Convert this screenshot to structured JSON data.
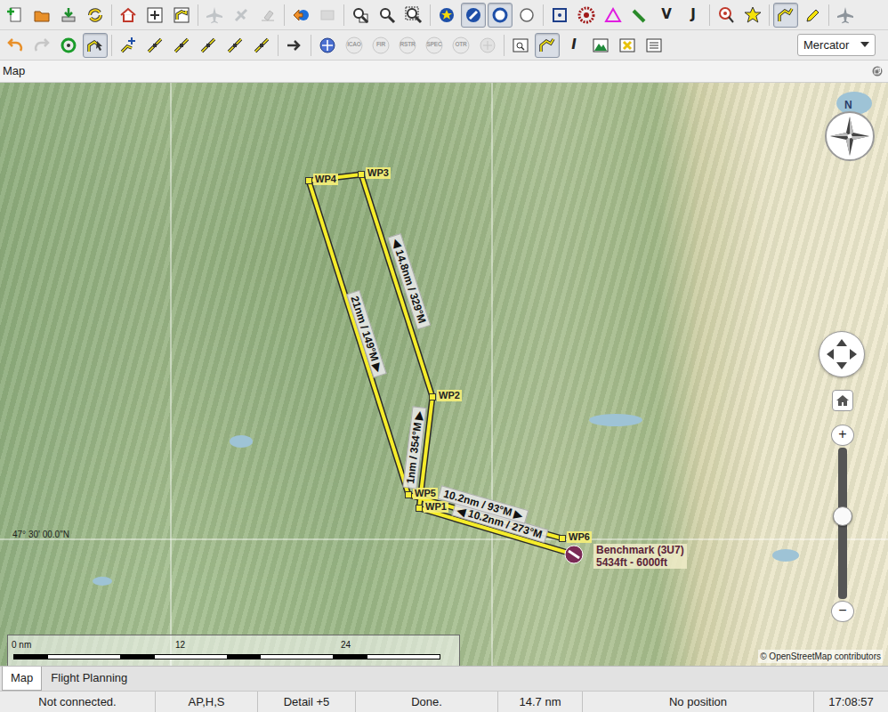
{
  "toolbars": [
    {
      "groups": [
        [
          {
            "kind": "new",
            "pressed": false,
            "disabled": false
          },
          {
            "kind": "open",
            "pressed": false,
            "disabled": false
          },
          {
            "kind": "save",
            "pressed": false,
            "disabled": false
          },
          {
            "kind": "reload",
            "pressed": false,
            "disabled": false
          }
        ],
        [
          {
            "kind": "home",
            "pressed": false,
            "disabled": false
          },
          {
            "kind": "center",
            "pressed": false,
            "disabled": false
          },
          {
            "kind": "routebox",
            "pressed": false,
            "disabled": false
          }
        ],
        [
          {
            "kind": "plane",
            "pressed": false,
            "disabled": true
          },
          {
            "kind": "satellite",
            "pressed": false,
            "disabled": true
          },
          {
            "kind": "erase",
            "pressed": false,
            "disabled": true
          }
        ],
        [
          {
            "kind": "back",
            "pressed": false,
            "disabled": false
          },
          {
            "kind": "forward",
            "pressed": false,
            "disabled": true
          }
        ],
        [
          {
            "kind": "zoomdoc",
            "pressed": false,
            "disabled": false
          },
          {
            "kind": "zoom",
            "pressed": false,
            "disabled": false
          },
          {
            "kind": "zoomrect",
            "pressed": false,
            "disabled": false
          }
        ],
        [
          {
            "kind": "starcircle",
            "pressed": false,
            "disabled": false
          },
          {
            "kind": "slash",
            "pressed": true,
            "disabled": false
          },
          {
            "kind": "ring",
            "pressed": true,
            "disabled": false
          },
          {
            "kind": "circle",
            "pressed": false,
            "disabled": false
          }
        ],
        [
          {
            "kind": "vor",
            "pressed": false,
            "disabled": false
          },
          {
            "kind": "ndb",
            "pressed": false,
            "disabled": false
          },
          {
            "kind": "triangle",
            "pressed": false,
            "disabled": false
          },
          {
            "kind": "marker",
            "pressed": false,
            "disabled": false
          },
          {
            "kind": "letter",
            "label": "V",
            "pressed": false,
            "disabled": false
          },
          {
            "kind": "letter",
            "label": "J",
            "pressed": false,
            "disabled": false
          }
        ],
        [
          {
            "kind": "target",
            "pressed": false,
            "disabled": false
          },
          {
            "kind": "star",
            "pressed": false,
            "disabled": false
          }
        ],
        [
          {
            "kind": "route",
            "pressed": true,
            "disabled": false
          },
          {
            "kind": "pen",
            "pressed": false,
            "disabled": false
          }
        ],
        [
          {
            "kind": "plane",
            "pressed": false,
            "disabled": false
          }
        ]
      ]
    },
    {
      "groups": [
        [
          {
            "kind": "undo",
            "pressed": false,
            "disabled": false
          },
          {
            "kind": "redo",
            "pressed": false,
            "disabled": true
          },
          {
            "kind": "search",
            "pressed": false,
            "disabled": false
          },
          {
            "kind": "pointer",
            "pressed": true,
            "disabled": false
          }
        ],
        [
          {
            "kind": "addroute",
            "pressed": false,
            "disabled": false
          },
          {
            "kind": "leg",
            "pressed": false,
            "disabled": false
          },
          {
            "kind": "leg",
            "pressed": false,
            "disabled": false
          },
          {
            "kind": "leg",
            "pressed": false,
            "disabled": false
          },
          {
            "kind": "leg",
            "pressed": false,
            "disabled": false
          },
          {
            "kind": "leg",
            "pressed": false,
            "disabled": false
          }
        ],
        [
          {
            "kind": "planearrow",
            "pressed": false,
            "disabled": false
          }
        ],
        [
          {
            "kind": "compass",
            "pressed": false,
            "disabled": false
          },
          {
            "kind": "airspace",
            "label": "ICAO",
            "pressed": false,
            "disabled": true
          },
          {
            "kind": "airspace",
            "label": "FIR",
            "pressed": false,
            "disabled": true
          },
          {
            "kind": "airspace",
            "label": "RSTR",
            "pressed": false,
            "disabled": true
          },
          {
            "kind": "airspace",
            "label": "SPEC",
            "pressed": false,
            "disabled": true
          },
          {
            "kind": "airspace",
            "label": "OTR",
            "pressed": false,
            "disabled": true
          },
          {
            "kind": "airspacegrey",
            "pressed": false,
            "disabled": true
          }
        ],
        [
          {
            "kind": "window",
            "pressed": false,
            "disabled": false
          },
          {
            "kind": "route",
            "pressed": true,
            "disabled": false
          },
          {
            "kind": "letter",
            "label": "I",
            "pressed": false,
            "disabled": false
          },
          {
            "kind": "mountain",
            "pressed": false,
            "disabled": false
          },
          {
            "kind": "cross",
            "pressed": false,
            "disabled": false
          },
          {
            "kind": "list",
            "pressed": false,
            "disabled": false
          }
        ]
      ],
      "projection": "Mercator"
    }
  ],
  "panel": {
    "title": "Map"
  },
  "map": {
    "grid_label": "47° 30' 00.0\"N",
    "waypoints": [
      {
        "label": "WP1"
      },
      {
        "label": "WP2"
      },
      {
        "label": "WP3"
      },
      {
        "label": "WP4"
      },
      {
        "label": "WP5"
      },
      {
        "label": "WP6"
      }
    ],
    "legs": [
      {
        "label": "◀ 10.2nm / 273°M"
      },
      {
        "label": "1nm / 354°M ▶"
      },
      {
        "label": "◀ 14.8nm / 329°M"
      },
      {
        "label": "21nm / 149°M ▶"
      },
      {
        "label": "10.2nm / 93°M ▶"
      }
    ],
    "airport": {
      "name": "Benchmark (3U7)",
      "elevation": "5434ft - 6000ft"
    },
    "compass": "N",
    "scale": [
      "0 nm",
      "12",
      "24"
    ],
    "attribution": "© OpenStreetMap contributors",
    "zoom": {
      "in": "+",
      "out": "−",
      "level": 0.55
    }
  },
  "tabs": [
    {
      "label": "Map",
      "selected": true
    },
    {
      "label": "Flight Planning",
      "selected": false
    }
  ],
  "status_bar": [
    "Not connected.",
    "AP,H,S",
    "Detail +5",
    "Done.",
    "14.7 nm",
    "No position",
    "17:08:57"
  ]
}
